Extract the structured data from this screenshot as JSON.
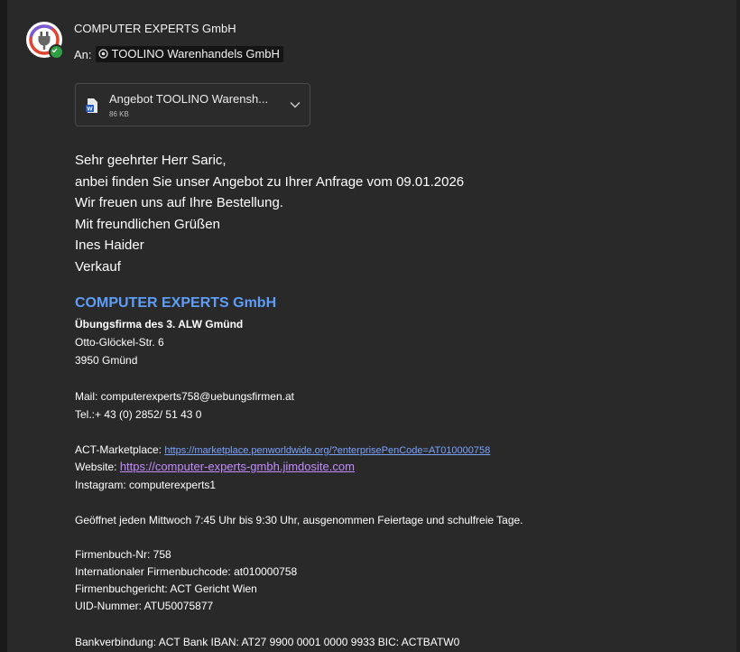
{
  "header": {
    "sender_name": "COMPUTER EXPERTS GmbH",
    "to_label": "An:",
    "recipient": "TOOLINO Warenhandels GmbH"
  },
  "attachment": {
    "name": "Angebot TOOLINO Waren­sh...",
    "size": "86 KB",
    "icon": "word-document-icon"
  },
  "body_lines": [
    "Sehr geehrter Herr Saric,",
    "anbei finden Sie unser Angebot zu Ihrer Anfrage vom 09.01.2026",
    "Wir freuen uns auf Ihre Bestellung.",
    "Mit freundlichen Grüßen",
    "Ines Haider",
    "Verkauf"
  ],
  "signature": {
    "company": "COMPUTER EXPERTS GmbH",
    "subtitle": "Übungsfirma des 3. ALW Gmünd",
    "street": "Otto-Glöckel-Str. 6",
    "city": "3950 Gmünd",
    "mail": "Mail: computerexperts758@uebungsfirmen.at",
    "tel": "Tel.:+ 43 (0) 2852/ 51 43 0",
    "marketplace_label": "ACT-Marketplace: ",
    "marketplace_url": "https://marketplace.penworldwide.org/?enterprisePenCode=AT010000758",
    "website_label": "Website: ",
    "website_url": "https://computer-experts-gmbh.jimdosite.com",
    "instagram": "Instagram: computerexperts1",
    "hours": "Geöffnet jeden Mittwoch 7:45 Uhr bis 9:30 Uhr, ausgenommen Feiertage und schulfreie Tage.",
    "firmenbuch_nr": "Firmenbuch-Nr: 758",
    "int_code": "Internationaler Firmenbuchcode: at010000758",
    "gericht": "Firmenbuchgericht: ACT Gericht Wien",
    "uid": "UID-Nummer: ATU50075877",
    "bank": "Bankverbindung: ACT Bank  IBAN: AT27 9900 0001 0000 9933   BIC: ACTBATW0"
  },
  "colors": {
    "background": "#292929",
    "company_blue": "#5e9ef8",
    "link_blue": "#7aa3ff",
    "link_purple": "#c38cff",
    "presence_green": "#2ea043"
  }
}
